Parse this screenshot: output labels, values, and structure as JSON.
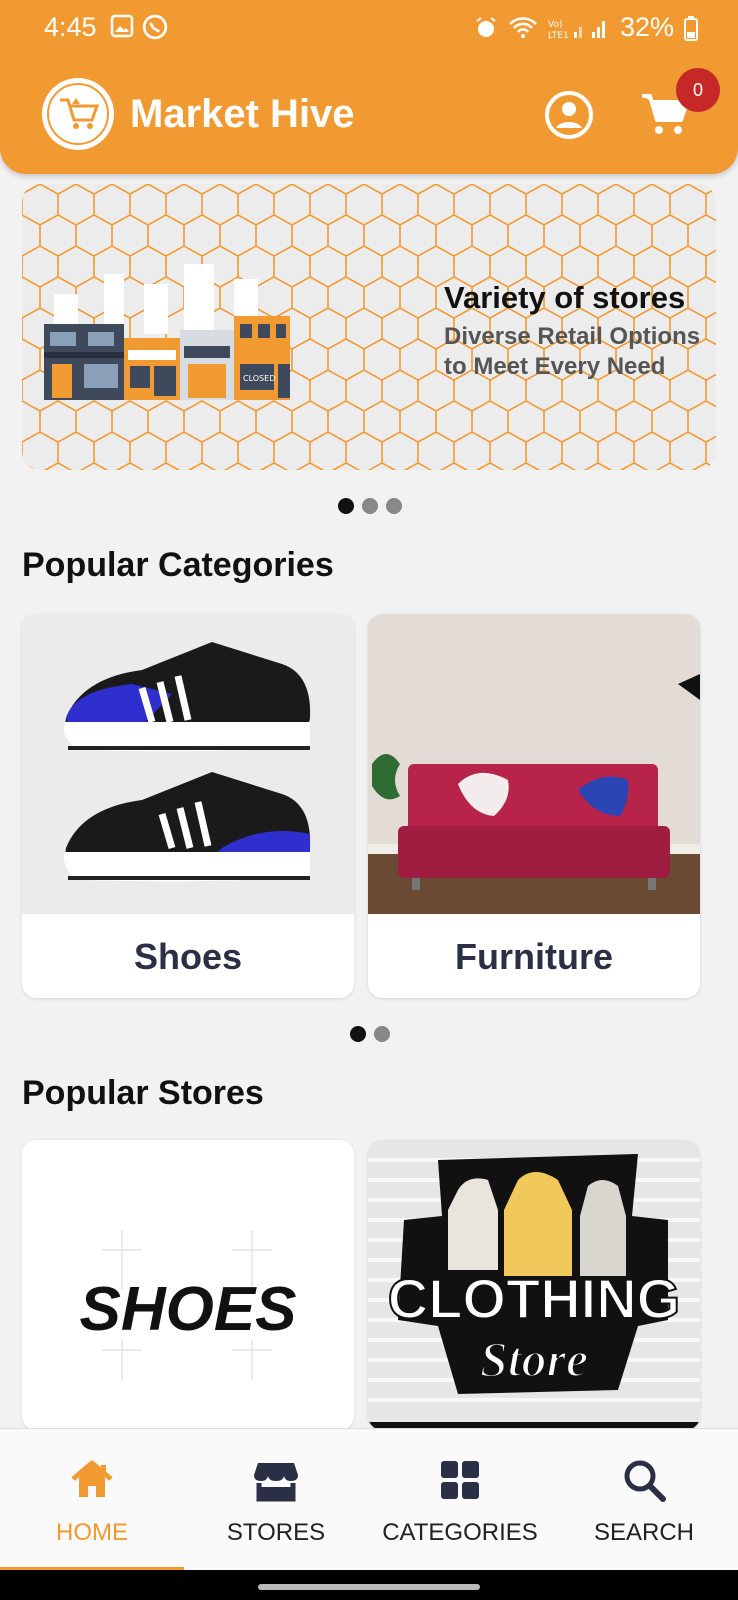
{
  "status_bar": {
    "time": "4:45",
    "battery": "32%"
  },
  "header": {
    "app_title": "Market Hive",
    "cart_count": "0"
  },
  "banner": {
    "title": "Variety of stores",
    "subtitle": "Diverse Retail Options to Meet Every Need",
    "slides": 3,
    "active_slide": 0
  },
  "categories": {
    "title": "Popular Categories",
    "items": [
      {
        "label": "Shoes"
      },
      {
        "label": "Furniture"
      }
    ],
    "pages": 2,
    "active_page": 0
  },
  "stores": {
    "title": "Popular Stores",
    "items": [
      {
        "logo_text": "SHOES"
      },
      {
        "logo_text_line1": "CLOTHING",
        "logo_text_line2": "Store"
      }
    ]
  },
  "bottom_nav": {
    "items": [
      {
        "label": "HOME",
        "icon": "home-icon",
        "active": true
      },
      {
        "label": "STORES",
        "icon": "store-icon",
        "active": false
      },
      {
        "label": "CATEGORIES",
        "icon": "grid-icon",
        "active": false
      },
      {
        "label": "SEARCH",
        "icon": "search-icon",
        "active": false
      }
    ]
  },
  "colors": {
    "brand": "#f29a32",
    "badge": "#c62828",
    "nav_icon": "#2a2f45"
  }
}
